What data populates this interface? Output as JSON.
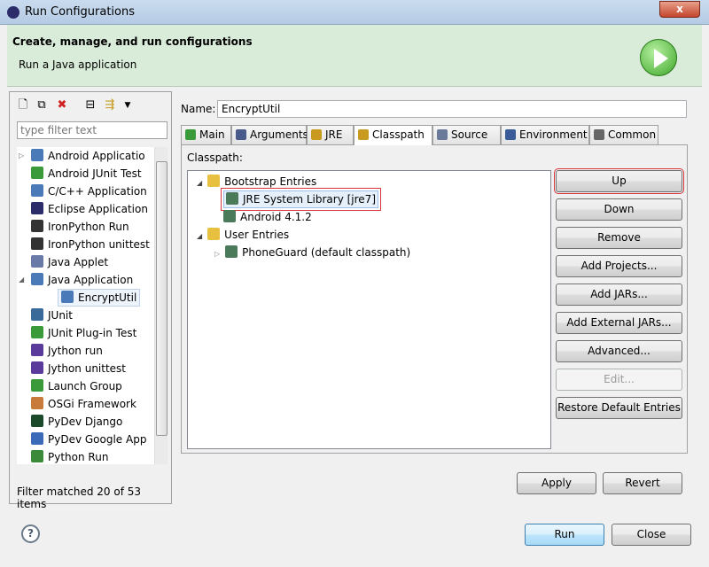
{
  "window": {
    "title": "Run Configurations",
    "close": "x"
  },
  "header": {
    "title": "Create, manage, and run configurations",
    "subtitle": "Run a Java application"
  },
  "left": {
    "filter_placeholder": "type filter text",
    "items": [
      {
        "label": "Android Applicatio",
        "color": "#4a7ab8",
        "expand": "▷"
      },
      {
        "label": "Android JUnit Test",
        "color": "#3a9a3a"
      },
      {
        "label": "C/C++ Application",
        "color": "#4a7ab8"
      },
      {
        "label": "Eclipse Application",
        "color": "#2c2c6a"
      },
      {
        "label": "IronPython Run",
        "color": "#333333"
      },
      {
        "label": "IronPython unittest",
        "color": "#333333"
      },
      {
        "label": "Java Applet",
        "color": "#6a7aa8"
      },
      {
        "label": "Java Application",
        "color": "#4a7ab8",
        "expand": "◢"
      },
      {
        "label": "EncryptUtil",
        "color": "#4a7ab8",
        "child": true
      },
      {
        "label": "JUnit",
        "color": "#3a6a9a"
      },
      {
        "label": "JUnit Plug-in Test",
        "color": "#3a9a3a"
      },
      {
        "label": "Jython run",
        "color": "#5a3a9a"
      },
      {
        "label": "Jython unittest",
        "color": "#5a3a9a"
      },
      {
        "label": "Launch Group",
        "color": "#3a9a3a"
      },
      {
        "label": "OSGi Framework",
        "color": "#c87a3a"
      },
      {
        "label": "PyDev Django",
        "color": "#1a4a2a"
      },
      {
        "label": "PyDev Google App",
        "color": "#3a6ab8"
      },
      {
        "label": "Python Run",
        "color": "#3a8a3a"
      }
    ],
    "status": "Filter matched 20 of 53 items"
  },
  "name": {
    "label": "Name:",
    "value": "EncryptUtil"
  },
  "tabs": [
    "Main",
    "Arguments",
    "JRE",
    "Classpath",
    "Source",
    "Environment",
    "Common"
  ],
  "classpath": {
    "label": "Classpath:",
    "tree": [
      {
        "label": "Bootstrap Entries",
        "level": 0
      },
      {
        "label": "JRE System Library [jre7]",
        "level": 1,
        "selected": true
      },
      {
        "label": "Android 4.1.2",
        "level": 1
      },
      {
        "label": "User Entries",
        "level": 0
      },
      {
        "label": "PhoneGuard (default classpath)",
        "level": 1
      }
    ],
    "buttons": [
      "Up",
      "Down",
      "Remove",
      "Add Projects...",
      "Add JARs...",
      "Add External JARs...",
      "Advanced...",
      "Edit...",
      "Restore Default Entries"
    ]
  },
  "actions": {
    "apply": "Apply",
    "revert": "Revert",
    "run": "Run",
    "close": "Close",
    "help": "?"
  }
}
